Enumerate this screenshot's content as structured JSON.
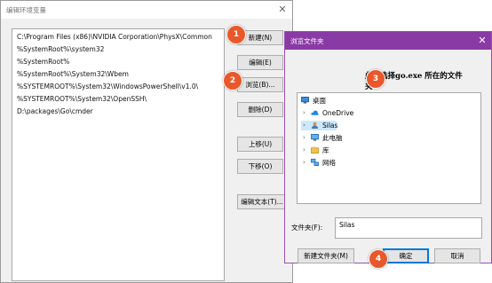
{
  "env_dialog": {
    "title": "编辑环境变量",
    "close": "✕",
    "paths": [
      "C:\\Program Files (x86)\\NVIDIA Corporation\\PhysX\\Common",
      "%SystemRoot%\\system32",
      "%SystemRoot%",
      "%SystemRoot%\\System32\\Wbem",
      "%SYSTEMROOT%\\System32\\WindowsPowerShell\\v1.0\\",
      "%SYSTEMROOT%\\System32\\OpenSSH\\",
      "D:\\packages\\Go\\cmder"
    ],
    "buttons": {
      "new": "新建(N)",
      "edit": "编辑(E)",
      "browse": "浏览(B)...",
      "delete": "删除(D)",
      "move_up": "上移(U)",
      "move_down": "下移(O)",
      "edit_text": "编辑文本(T)..."
    }
  },
  "browse_dialog": {
    "title": "浏览文件夹",
    "close": "✕",
    "annotation": "此处选择go.exe 所在的文件夹",
    "tree": [
      {
        "label": "桌面",
        "icon": "desktop-icon"
      },
      {
        "label": "OneDrive",
        "icon": "onedrive-icon"
      },
      {
        "label": "Silas",
        "icon": "user-folder-icon"
      },
      {
        "label": "此电脑",
        "icon": "this-pc-icon"
      },
      {
        "label": "库",
        "icon": "library-icon"
      },
      {
        "label": "网络",
        "icon": "network-icon"
      }
    ],
    "folder_label": "文件夹(F):",
    "folder_value": "Silas",
    "buttons": {
      "new_folder": "新建文件夹(M)",
      "ok": "确定",
      "cancel": "取消"
    }
  },
  "badges": [
    "1",
    "2",
    "3",
    "4"
  ],
  "colors": {
    "badge": "#e8582b",
    "browse_titlebar": "#8a3aa5",
    "focus_border": "#0078d7"
  }
}
